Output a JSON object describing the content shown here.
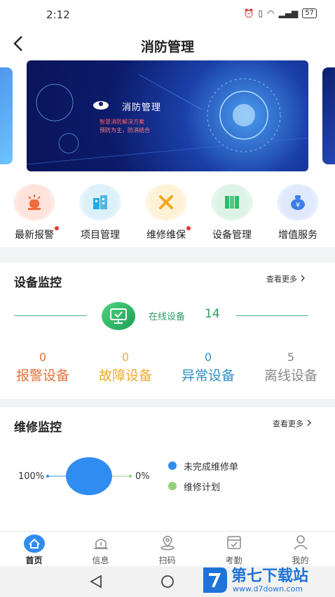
{
  "status_bar": {
    "time": "2:12",
    "battery": "57"
  },
  "header": {
    "title": "消防管理"
  },
  "banner": {
    "title": "消防管理",
    "sub1": "智慧消防解决方案",
    "sub2": "预防为主，防消结合"
  },
  "quick_menu": [
    {
      "label": "最新报警",
      "icon": "alarm-light-icon",
      "bg": "#fde3dc",
      "color": "#f26b3a",
      "dot": true
    },
    {
      "label": "项目管理",
      "icon": "building-icon",
      "bg": "#dcf0fa",
      "color": "#29a9e0",
      "dot": false
    },
    {
      "label": "维修维保",
      "icon": "wrench-icon",
      "bg": "#fdf1d6",
      "color": "#f5a623",
      "dot": true
    },
    {
      "label": "设备管理",
      "icon": "server-icon",
      "bg": "#ddf3e6",
      "color": "#2ebd6b",
      "dot": false
    },
    {
      "label": "增值服务",
      "icon": "money-bag-icon",
      "bg": "#dfe9fb",
      "color": "#3b7ee8",
      "dot": false
    }
  ],
  "device_monitor": {
    "title": "设备监控",
    "more": "查看更多",
    "online_label": "在线设备",
    "online_count": "14",
    "stats": [
      {
        "value": "0",
        "label": "报警设备",
        "color": "#e2703a"
      },
      {
        "value": "0",
        "label": "故障设备",
        "color": "#f0a92e"
      },
      {
        "value": "0",
        "label": "异常设备",
        "color": "#2e8fc7"
      },
      {
        "value": "5",
        "label": "离线设备",
        "color": "#8a8a8a"
      }
    ]
  },
  "repair_monitor": {
    "title": "维修监控",
    "more": "查看更多",
    "pct_left": "100%",
    "pct_right": "0%",
    "legend": [
      {
        "label": "未完成维修单",
        "color": "#2f8cf0"
      },
      {
        "label": "维修计划",
        "color": "#8fd07a"
      }
    ]
  },
  "chart_data": {
    "type": "pie",
    "series": [
      {
        "name": "未完成维修单",
        "value": 100
      },
      {
        "name": "维修计划",
        "value": 0
      }
    ]
  },
  "tabbar": [
    {
      "label": "首页",
      "icon": "home-icon",
      "active": true
    },
    {
      "label": "信息",
      "icon": "alert-icon",
      "active": false
    },
    {
      "label": "扫码",
      "icon": "location-scan-icon",
      "active": false
    },
    {
      "label": "考勤",
      "icon": "calendar-check-icon",
      "active": false
    },
    {
      "label": "我的",
      "icon": "user-icon",
      "active": false
    }
  ],
  "watermark": {
    "brand": "第七下载站",
    "url": "www.d7down.com"
  }
}
